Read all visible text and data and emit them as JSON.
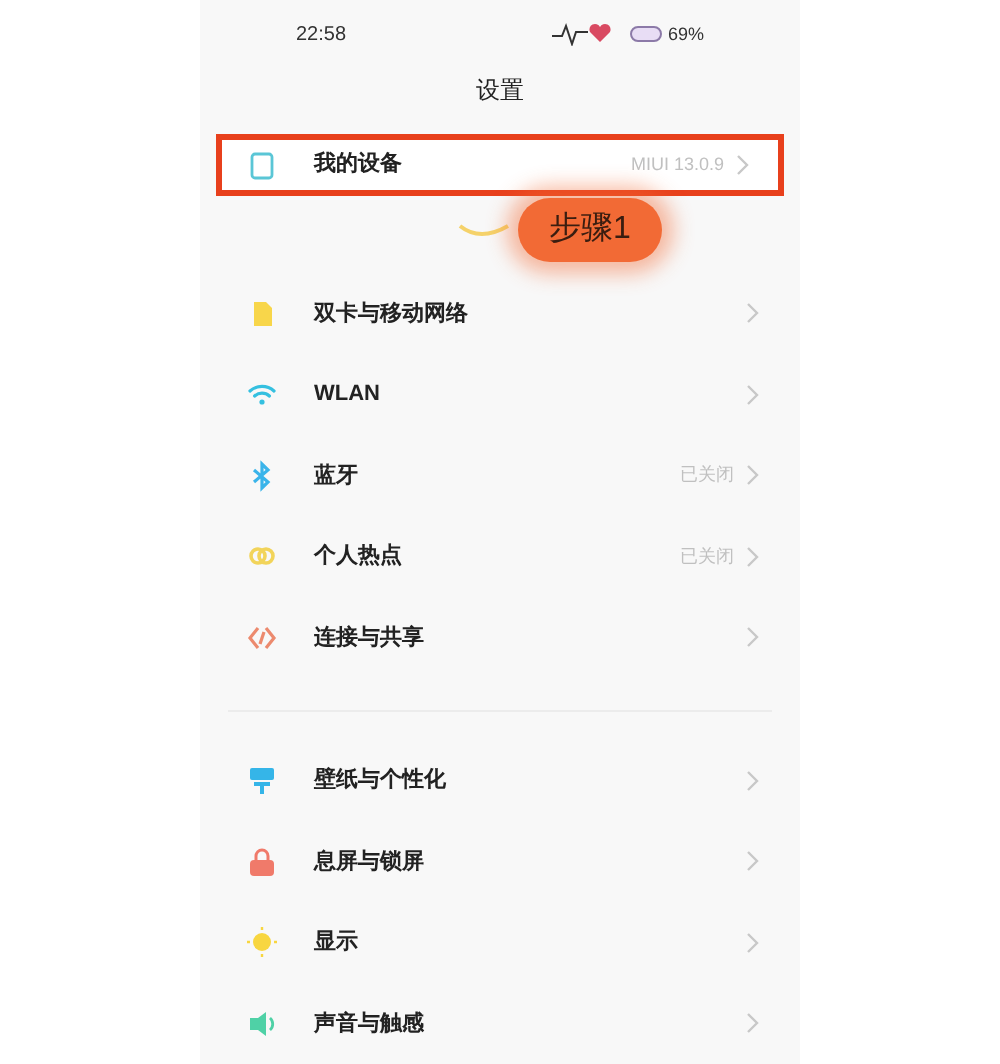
{
  "status_bar": {
    "time": "22:58",
    "battery": "69%"
  },
  "title": "设置",
  "device_row": {
    "label": "我的设备",
    "value": "MIUI 13.0.9",
    "highlighted": true
  },
  "annotation": {
    "text": "步骤1"
  },
  "groups": [
    {
      "items": [
        {
          "kind": "sim",
          "label": "双卡与移动网络"
        },
        {
          "kind": "wifi",
          "label": "WLAN"
        },
        {
          "kind": "bluetooth",
          "label": "蓝牙",
          "value": "已关闭"
        },
        {
          "kind": "hotspot",
          "label": "个人热点",
          "value": "已关闭"
        },
        {
          "kind": "share",
          "label": "连接与共享"
        }
      ]
    },
    {
      "items": [
        {
          "kind": "wallpaper",
          "label": "壁纸与个性化"
        },
        {
          "kind": "lock",
          "label": "息屏与锁屏"
        },
        {
          "kind": "sun",
          "label": "显示"
        },
        {
          "kind": "sound",
          "label": "声音与触感"
        }
      ]
    }
  ]
}
